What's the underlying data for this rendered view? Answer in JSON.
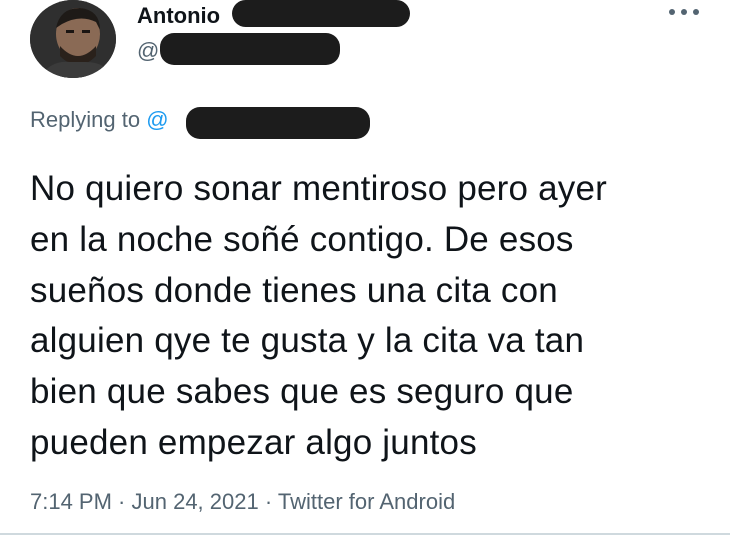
{
  "author": {
    "display_name": "Antonio",
    "handle_prefix": "@",
    "avatar_icon": "profile-photo"
  },
  "reply": {
    "label": "Replying to ",
    "mention_prefix": "@"
  },
  "tweet": {
    "text": "No quiero sonar mentiroso pero ayer\nen la noche soñé contigo. De esos\nsueños donde tienes una cita con\nalguien qye te gusta y la cita va tan\nbien que sabes que es seguro que\npueden empezar algo juntos"
  },
  "meta": {
    "time": "7:14 PM",
    "separator": " · ",
    "date": "Jun 24, 2021",
    "source": "Twitter for Android"
  },
  "colors": {
    "text": "#0f1419",
    "secondary": "#536471",
    "accent": "#1d9bf0",
    "redaction": "#1c1c1c"
  },
  "icons": {
    "more": "more-horizontal-icon"
  }
}
